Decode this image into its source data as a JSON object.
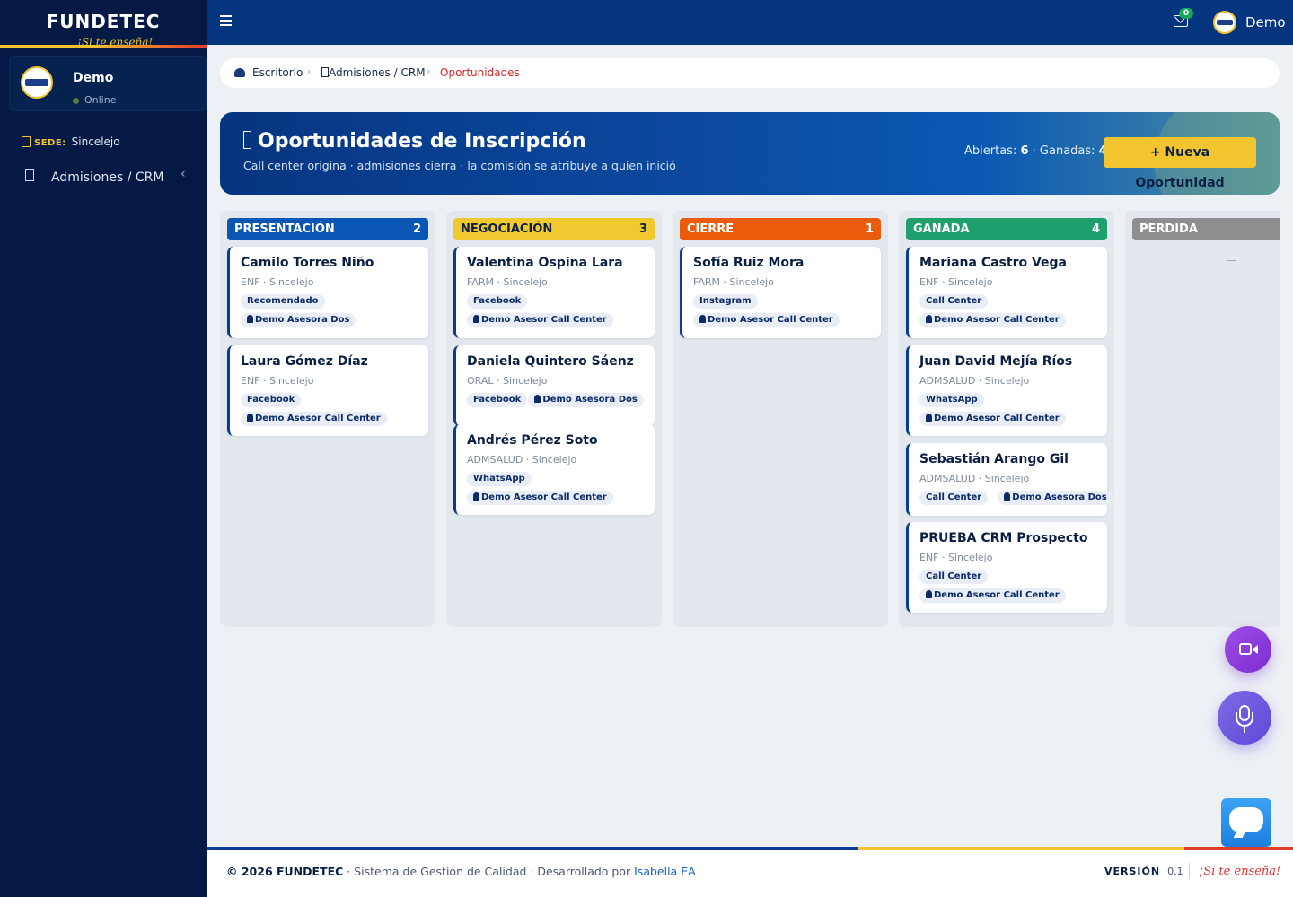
{
  "sidebar": {
    "brand": "FUNDETEC",
    "slogan": "¡Si te enseña!",
    "user_name": "Demo",
    "user_status": "Online",
    "sede_label": "SEDE:",
    "sede_value": "Sincelejo",
    "nav": [
      {
        "label": "Admisiones / CRM"
      }
    ]
  },
  "header": {
    "notifications_count": "0",
    "user_name": "Demo"
  },
  "breadcrumb": [
    "Escritorio",
    "Admisiones / CRM",
    "Oportunidades"
  ],
  "hero": {
    "title": "Oportunidades de Inscripción",
    "subtitle": "Call center origina · admisiones cierra · la comisión se atribuye a quien inició",
    "open_label": "Abiertas:",
    "open_count": "6",
    "won_label": "· Ganadas:",
    "won_count": "4",
    "new_button": "+ Nueva Oportunidad"
  },
  "board": {
    "columns": [
      {
        "title": "PRESENTACIÓN",
        "count": "2",
        "color": "#0a56b5",
        "cards": [
          {
            "name": "Camilo Torres Niño",
            "meta": "ENF · Sincelejo",
            "source": "Recomendado",
            "advisor": "Demo Asesora Dos"
          },
          {
            "name": "Laura Gómez Díaz",
            "meta": "ENF · Sincelejo",
            "source": "Facebook",
            "advisor": "Demo Asesor Call Center"
          }
        ]
      },
      {
        "title": "NEGOCIACIÓN",
        "count": "3",
        "color": "#f0c92e",
        "cards": [
          {
            "name": "Valentina Ospina Lara",
            "meta": "FARM · Sincelejo",
            "source": "Facebook",
            "advisor": "Demo Asesor Call Center"
          },
          {
            "name": "Daniela Quintero Sáenz",
            "meta": "ORAL · Sincelejo",
            "source": "Facebook",
            "advisor": "Demo Asesora Dos"
          },
          {
            "name": "Andrés Pérez Soto",
            "meta": "ADMSALUD · Sincelejo",
            "source": "WhatsApp",
            "advisor": "Demo Asesor Call Center"
          }
        ]
      },
      {
        "title": "CIERRE",
        "count": "1",
        "color": "#ea5b0c",
        "cards": [
          {
            "name": "Sofía Ruiz Mora",
            "meta": "FARM · Sincelejo",
            "source": "Instagram",
            "advisor": "Demo Asesor Call Center"
          }
        ]
      },
      {
        "title": "GANADA",
        "count": "4",
        "color": "#1f9e6e",
        "cards": [
          {
            "name": "Mariana Castro Vega",
            "meta": "ENF · Sincelejo",
            "source": "Call Center",
            "advisor": "Demo Asesor Call Center"
          },
          {
            "name": "Juan David Mejía Ríos",
            "meta": "ADMSALUD · Sincelejo",
            "source": "WhatsApp",
            "advisor": "Demo Asesor Call Center"
          },
          {
            "name": "Sebastián Arango Gil",
            "meta": "ADMSALUD · Sincelejo",
            "source": "Call Center",
            "advisor": "Demo Asesora Dos"
          },
          {
            "name": "PRUEBA CRM Prospecto",
            "meta": "ENF · Sincelejo",
            "source": "Call Center",
            "advisor": "Demo Asesor Call Center"
          }
        ]
      },
      {
        "title": "PERDIDA",
        "count": "",
        "color": "#8e8e8e",
        "empty": "—",
        "cards": []
      }
    ]
  },
  "footer": {
    "copyright": "© 2026 FUNDETEC",
    "system": " · Sistema de Gestión de Calidad · Desarrollado por ",
    "developer": "Isabella EA",
    "version_label": "VERSIÓN",
    "version_value": "0.1",
    "slogan": "¡Si te enseña!"
  },
  "icons": {
    "menu": "hamburger-icon",
    "mail": "envelope-icon",
    "home": "dashboard-icon",
    "sede": "building-icon",
    "advisor": "user-icon",
    "video": "video-camera-icon",
    "mic": "microphone-icon",
    "chat": "chat-icon"
  }
}
